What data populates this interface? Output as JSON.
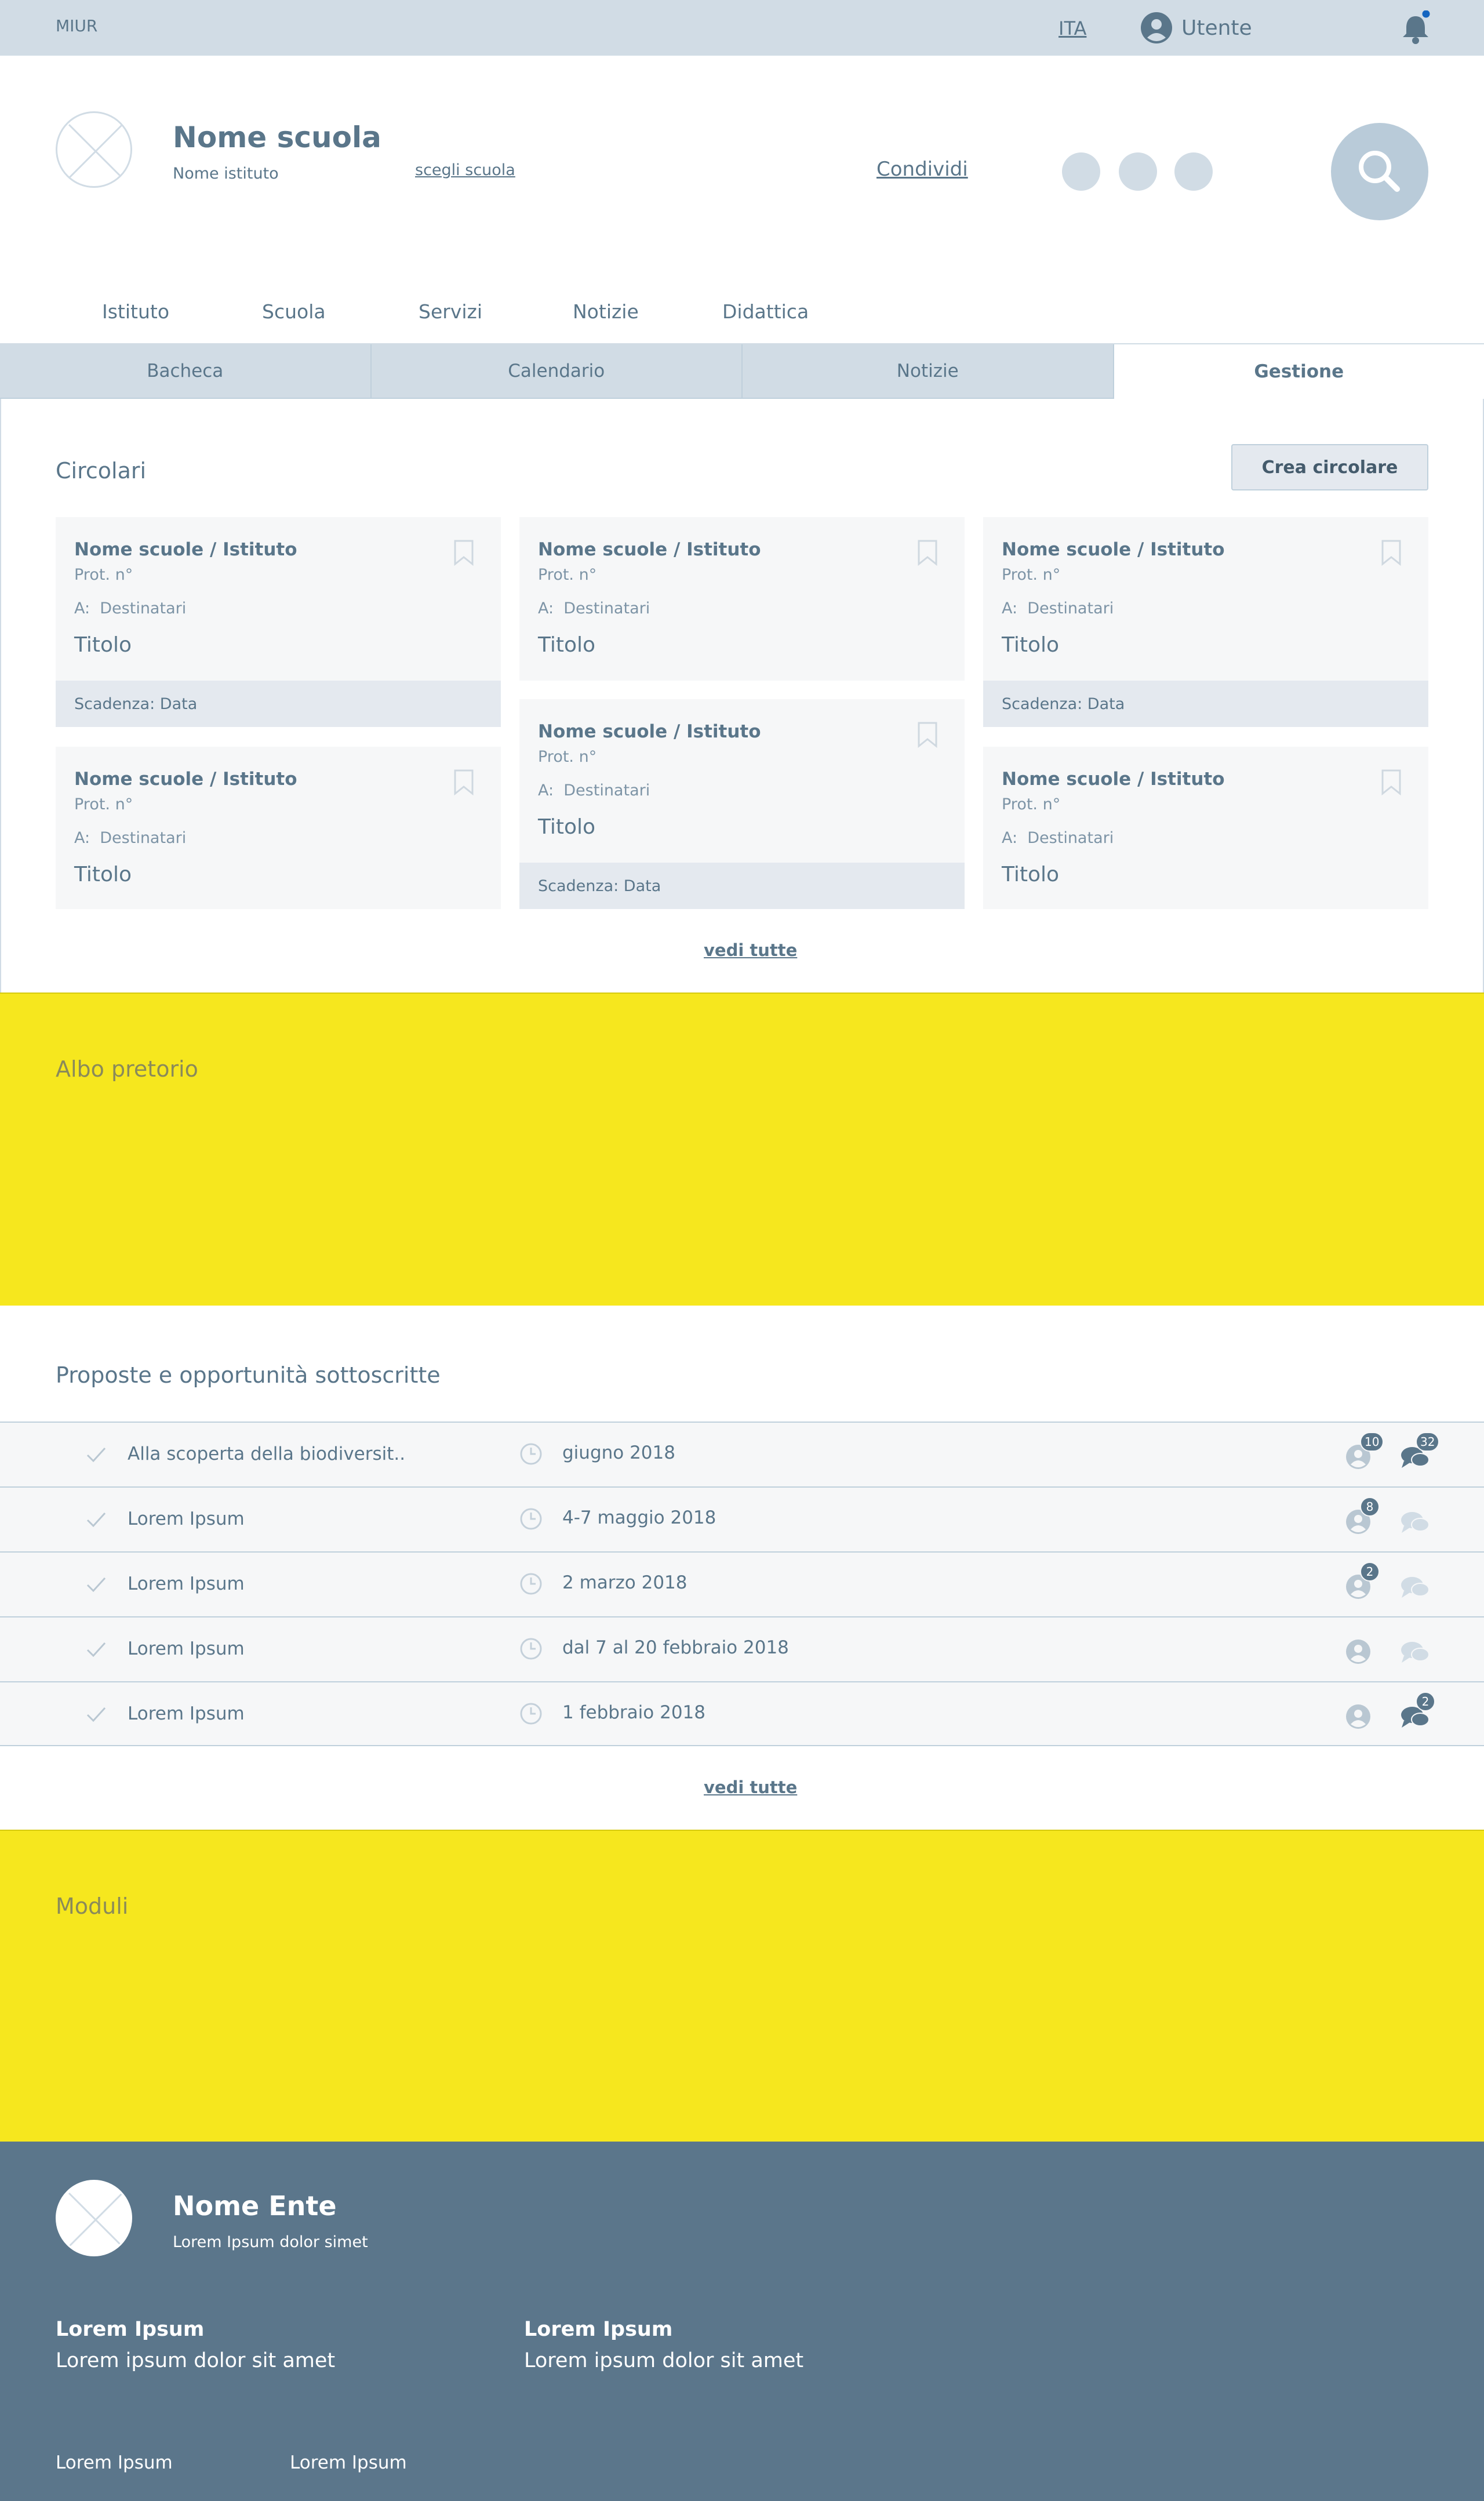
{
  "topbar": {
    "brand": "MIUR",
    "lang": "ITA",
    "user": "Utente"
  },
  "header": {
    "school_name": "Nome scuola",
    "institute": "Nome istituto",
    "choose_school": "scegli scuola",
    "share": "Condividi"
  },
  "main_nav": [
    "Istituto",
    "Scuola",
    "Servizi",
    "Notizie",
    "Didattica"
  ],
  "tabs": [
    "Bacheca",
    "Calendario",
    "Notizie",
    "Gestione"
  ],
  "active_tab": "Gestione",
  "circolari": {
    "title": "Circolari",
    "create_button": "Crea circolare",
    "see_all": "vedi tutte",
    "cards": [
      {
        "institute": "Nome scuole / Istituto",
        "prot": "Prot. n°",
        "dest_prefix": "A:",
        "dest": "Destinatari",
        "title": "Titolo",
        "deadline": "Scadenza: Data"
      },
      {
        "institute": "Nome scuole / Istituto",
        "prot": "Prot. n°",
        "dest_prefix": "A:",
        "dest": "Destinatari",
        "title": "Titolo",
        "deadline": ""
      },
      {
        "institute": "Nome scuole / Istituto",
        "prot": "Prot. n°",
        "dest_prefix": "A:",
        "dest": "Destinatari",
        "title": "Titolo",
        "deadline": "Scadenza: Data"
      },
      {
        "institute": "Nome scuole / Istituto",
        "prot": "Prot. n°",
        "dest_prefix": "A:",
        "dest": "Destinatari",
        "title": "Titolo",
        "deadline": ""
      },
      {
        "institute": "Nome scuole / Istituto",
        "prot": "Prot. n°",
        "dest_prefix": "A:",
        "dest": "Destinatari",
        "title": "Titolo",
        "deadline": "Scadenza: Data"
      },
      {
        "institute": "Nome scuole / Istituto",
        "prot": "Prot. n°",
        "dest_prefix": "A:",
        "dest": "Destinatari",
        "title": "Titolo",
        "deadline": ""
      }
    ]
  },
  "albo": {
    "title": "Albo pretorio"
  },
  "proposte": {
    "title": "Proposte e opportunità sottoscritte",
    "see_all": "vedi tutte",
    "rows": [
      {
        "label": "Alla scoperta della biodiversit..",
        "date": "giugno 2018",
        "users_badge": "10",
        "comments_badge": "32"
      },
      {
        "label": "Lorem Ipsum",
        "date": "4-7 maggio 2018",
        "users_badge": "8",
        "comments_badge": ""
      },
      {
        "label": "Lorem Ipsum",
        "date": "2 marzo 2018",
        "users_badge": "2",
        "comments_badge": ""
      },
      {
        "label": "Lorem Ipsum",
        "date": "dal 7 al 20 febbraio 2018",
        "users_badge": "",
        "comments_badge": ""
      },
      {
        "label": "Lorem Ipsum",
        "date": "1 febbraio 2018",
        "users_badge": "",
        "comments_badge": "2"
      }
    ]
  },
  "moduli": {
    "title": "Moduli"
  },
  "footer": {
    "ente_name": "Nome Ente",
    "ente_sub": "Lorem Ipsum dolor simet",
    "columns": [
      {
        "heading": "Lorem Ipsum",
        "text": "Lorem ipsum dolor sit amet"
      },
      {
        "heading": "Lorem Ipsum",
        "text": "Lorem ipsum dolor sit amet"
      }
    ],
    "links": [
      "Lorem Ipsum",
      "Lorem Ipsum"
    ]
  },
  "colors": {
    "accent": "#5a768a",
    "bar": "#d1dce5",
    "highlight": "#f6e71e",
    "footer": "#5b768b",
    "notification_dot": "#1565c0"
  },
  "icons": [
    "user-icon",
    "bell-icon",
    "search-icon",
    "bookmark-icon",
    "check-icon",
    "clock-icon",
    "chat-icon"
  ]
}
